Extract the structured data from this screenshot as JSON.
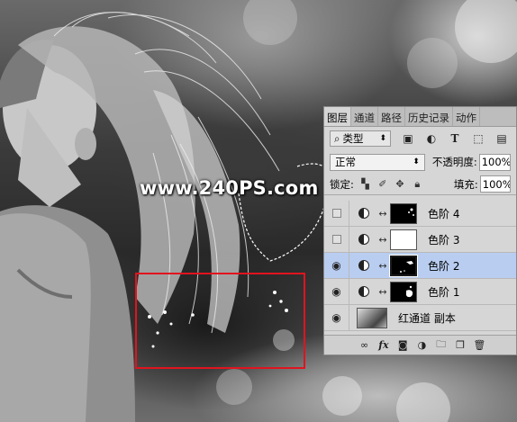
{
  "watermark": "www.240PS.com",
  "panel": {
    "tabs": [
      "图层",
      "通道",
      "路径",
      "历史记录",
      "动作"
    ],
    "active_tab": 0,
    "filter": {
      "label": "类型",
      "icon": "search-icon"
    },
    "blend_mode": "正常",
    "opacity_label": "不透明度:",
    "opacity_value": "100%",
    "lock_label": "锁定:",
    "fill_label": "填充:",
    "fill_value": "100%",
    "layers": [
      {
        "name": "色阶 4",
        "visible": false,
        "mask": "black-dots",
        "selected": false
      },
      {
        "name": "色阶 3",
        "visible": false,
        "mask": "white",
        "selected": false
      },
      {
        "name": "色阶 2",
        "visible": true,
        "mask": "black-strands",
        "selected": true
      },
      {
        "name": "色阶 1",
        "visible": true,
        "mask": "black-blob",
        "selected": false
      },
      {
        "name": "红通道 副本",
        "visible": true,
        "mask": "photo",
        "selected": false
      }
    ],
    "bottom_icons": [
      "link-icon",
      "fx-icon",
      "add-mask-icon",
      "adjustment-icon",
      "folder-icon",
      "new-layer-icon",
      "trash-icon"
    ]
  },
  "colors": {
    "selection_red": "#e0141e",
    "selected_row": "#b8cdf0"
  }
}
